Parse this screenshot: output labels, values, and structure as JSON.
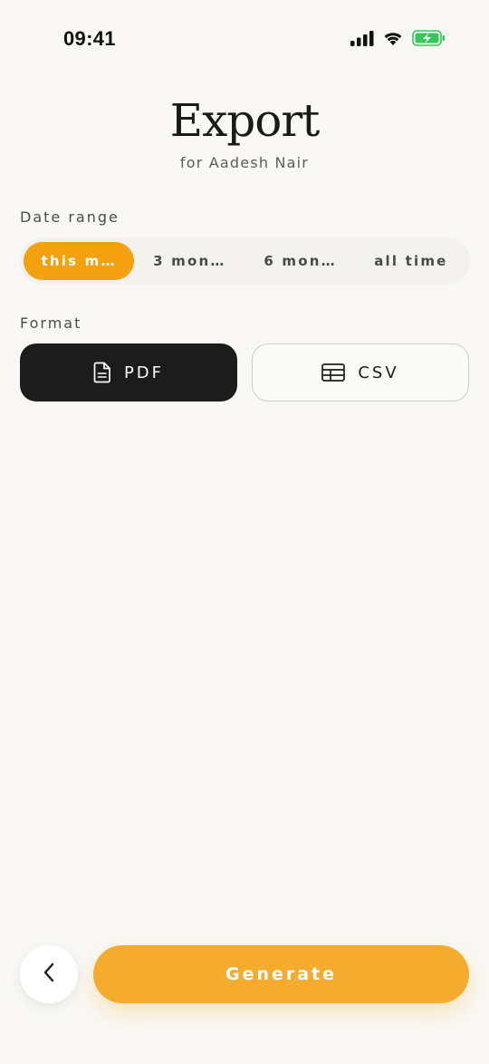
{
  "status_bar": {
    "time": "09:41",
    "icons": [
      "cellular-signal-icon",
      "wifi-icon",
      "battery-charging-icon"
    ]
  },
  "header": {
    "title": "Export",
    "subtitle": "for Aadesh Nair"
  },
  "date_range": {
    "label": "Date range",
    "options": [
      {
        "label": "this m…",
        "selected": true
      },
      {
        "label": "3 mon…",
        "selected": false
      },
      {
        "label": "6 mon…",
        "selected": false
      },
      {
        "label": "all time",
        "selected": false
      }
    ]
  },
  "format": {
    "label": "Format",
    "options": [
      {
        "label": "PDF",
        "icon": "document-icon",
        "selected": true
      },
      {
        "label": "CSV",
        "icon": "table-icon",
        "selected": false
      }
    ]
  },
  "footer": {
    "back_icon": "chevron-left-icon",
    "generate_label": "Generate"
  },
  "colors": {
    "accent": "#f4a00f",
    "generate": "#f5ac2e",
    "dark": "#1c1c1c",
    "background": "#f9f8f4",
    "battery_green": "#34c759"
  }
}
